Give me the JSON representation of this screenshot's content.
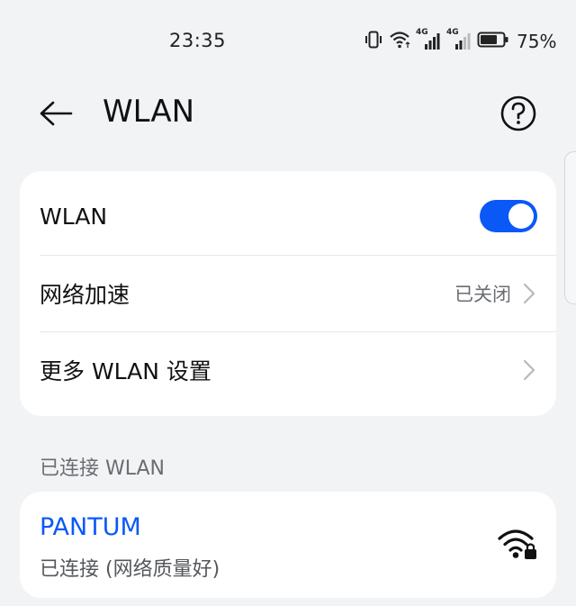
{
  "status_bar": {
    "time": "23:35",
    "network_type_1": "4G",
    "network_type_2": "4G",
    "battery_percent": "75%",
    "battery_level": 0.75,
    "icons": [
      "vibrate-icon",
      "wifi-status-icon",
      "signal-4g-icon",
      "signal-4g-icon",
      "battery-icon"
    ]
  },
  "header": {
    "title": "WLAN",
    "back_icon": "arrow-left-icon",
    "help_icon": "question-circle-icon"
  },
  "settings": {
    "wlan_toggle_label": "WLAN",
    "wlan_enabled": true,
    "acceleration_label": "网络加速",
    "acceleration_value": "已关闭",
    "more_settings_label": "更多 WLAN 设置"
  },
  "connected_section": {
    "header": "已连接 WLAN",
    "network": {
      "name": "PANTUM",
      "status": "已连接 (网络质量好)",
      "icon": "wifi-lock-icon"
    }
  },
  "colors": {
    "accent": "#0a59f7",
    "background": "#f1f3f5",
    "card": "#ffffff"
  }
}
